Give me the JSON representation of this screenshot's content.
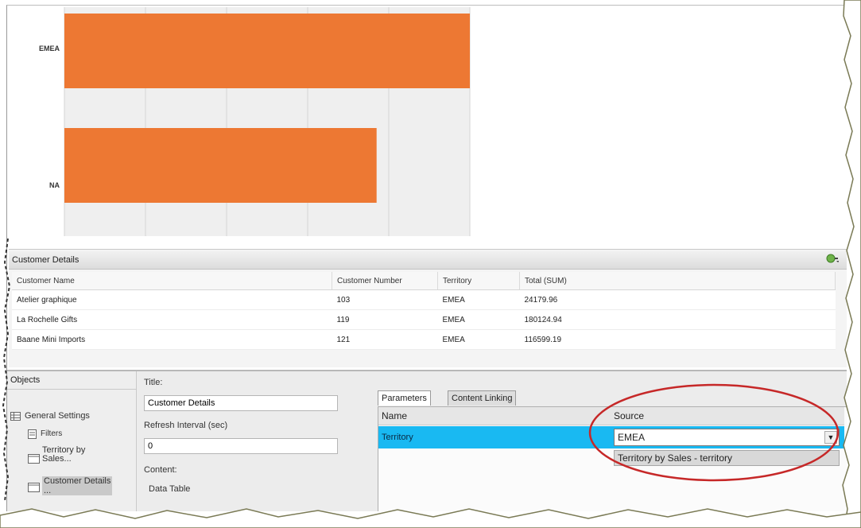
{
  "chart_data": {
    "type": "bar",
    "orientation": "horizontal",
    "categories": [
      "EMEA",
      "NA"
    ],
    "values": [
      100,
      77
    ],
    "xlim": [
      0,
      100
    ],
    "color": "#ED7833",
    "grid": true,
    "title": "",
    "xlabel": "",
    "ylabel": ""
  },
  "customer_details": {
    "title": "Customer Details",
    "columns": [
      "Customer Name",
      "Customer Number",
      "Territory",
      "Total (SUM)"
    ],
    "rows": [
      [
        "Atelier graphique",
        "103",
        "EMEA",
        "24179.96"
      ],
      [
        "La Rochelle Gifts",
        "119",
        "EMEA",
        "180124.94"
      ],
      [
        "Baane Mini Imports",
        "121",
        "EMEA",
        "116599.19"
      ]
    ]
  },
  "objects": {
    "header": "Objects",
    "items": [
      {
        "label": "General Settings",
        "icon": "settings-table-icon"
      },
      {
        "label": "Filters",
        "icon": "filter-icon"
      },
      {
        "label": "Territory by\nSales...",
        "icon": "chart-object-icon"
      },
      {
        "label": "Customer Details\n...",
        "icon": "table-object-icon"
      }
    ]
  },
  "properties": {
    "title_label": "Title:",
    "title_value": "Customer Details",
    "refresh_label": "Refresh Interval (sec)",
    "refresh_value": "0",
    "content_label": "Content:",
    "content_value": "Data Table"
  },
  "parameters": {
    "tabs": [
      "Parameters",
      "Content Linking"
    ],
    "active_tab": "Parameters",
    "name_header": "Name",
    "source_header": "Source",
    "row_name": "Territory",
    "source_value": "EMEA",
    "dropdown_option": "Territory by Sales - territory"
  },
  "colors": {
    "bar": "#ED7833",
    "selected_row": "#19B9F2",
    "highlight_ellipse": "#C62828"
  }
}
